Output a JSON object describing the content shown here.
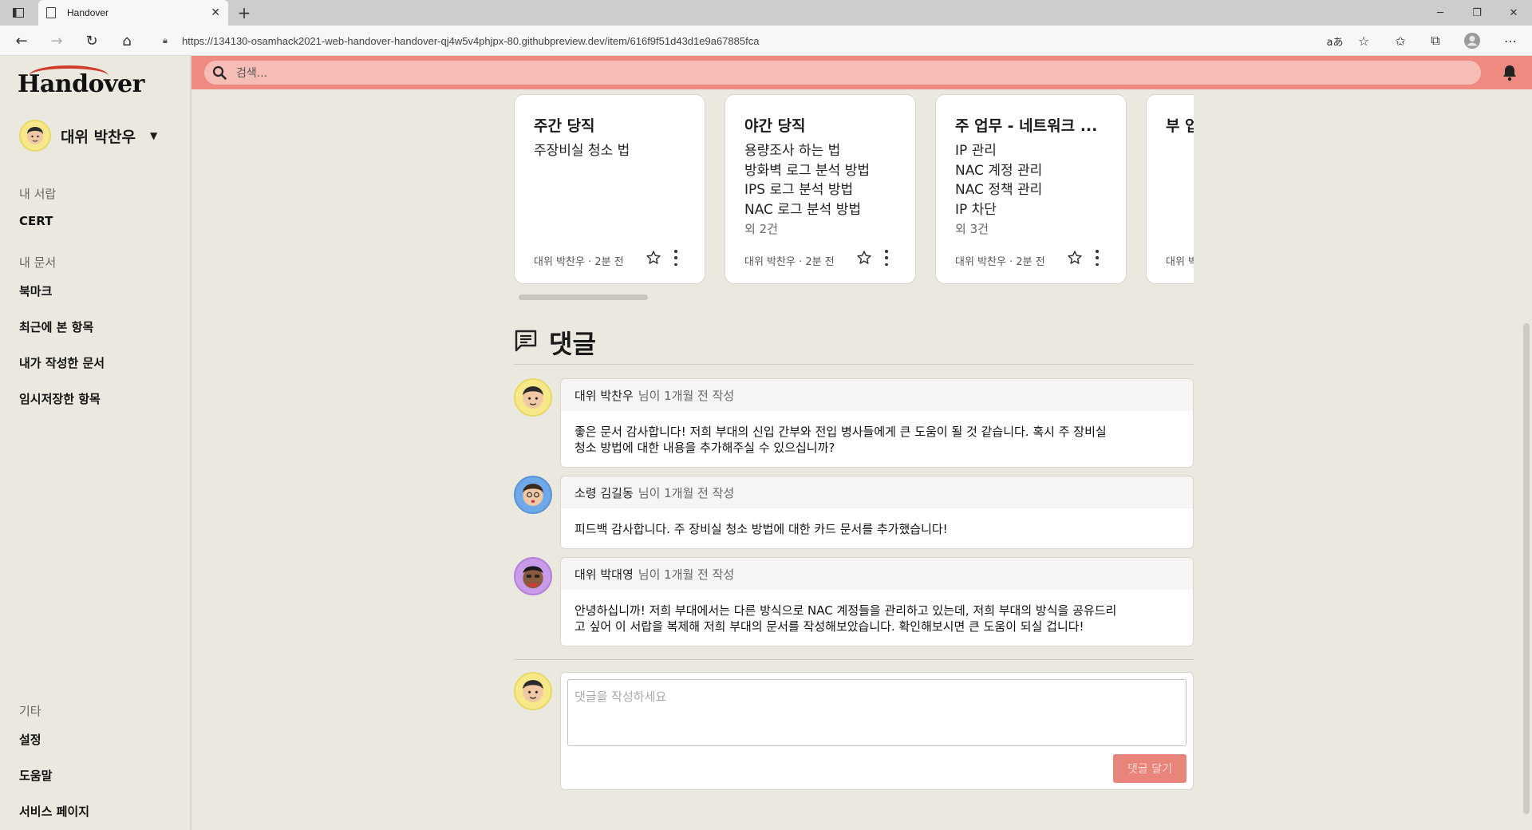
{
  "browser": {
    "tab_title": "Handover",
    "url": "https://134130-osamhack2021-web-handover-handover-qj4w5v4phjpx-80.githubpreview.dev/item/616f9f51d43d1e9a67885fca"
  },
  "sidebar": {
    "logo": "Handover",
    "user_name": "대위 박찬우",
    "sections": {
      "library": "내 서랍",
      "documents": "내 문서",
      "etc": "기타"
    },
    "library_items": [
      "CERT"
    ],
    "document_items": [
      "북마크",
      "최근에 본 항목",
      "내가 작성한 문서",
      "임시저장한 항목"
    ],
    "etc_items": [
      "설정",
      "도움말",
      "서비스 페이지"
    ]
  },
  "search": {
    "placeholder": "검색..."
  },
  "cards": [
    {
      "title": "주간 당직",
      "items": [
        "주장비실 청소 법"
      ],
      "more": "",
      "author": "대위 박찬우",
      "time": "2분 전"
    },
    {
      "title": "야간 당직",
      "items": [
        "용량조사 하는 법",
        "방화벽 로그 분석 방법",
        "IPS 로그 분석 방법",
        "NAC 로그 분석 방법"
      ],
      "more": "외 2건",
      "author": "대위 박찬우",
      "time": "2분 전"
    },
    {
      "title": "주 업무 - 네트워크 ...",
      "items": [
        "IP 관리",
        "NAC 계정 관리",
        "NAC 정책 관리",
        "IP 차단"
      ],
      "more": "외 3건",
      "author": "대위 박찬우",
      "time": "2분 전"
    },
    {
      "title": "부 업",
      "items": [],
      "more": "",
      "author": "대위 박",
      "time": ""
    }
  ],
  "comments_section": {
    "title": "댓글",
    "items": [
      {
        "author": "대위 박찬우",
        "meta": "님이 1개월 전 작성",
        "body_lines": [
          "좋은 문서 감사합니다! 저희 부대의 신입 간부와 전입 병사들에게 큰 도움이 될 것 같습니다. 혹시 주 장비실",
          "청소 방법에 대한 내용을 추가해주실 수 있으십니까?"
        ],
        "avatar_color": "#f7e98a"
      },
      {
        "author": "소령 김길동",
        "meta": "님이 1개월 전 작성",
        "body_lines": [
          "피드백 감사합니다. 주 장비실 청소 방법에 대한 카드 문서를 추가했습니다!"
        ],
        "avatar_color": "#6fa8e8"
      },
      {
        "author": "대위 박대영",
        "meta": "님이 1개월 전 작성",
        "body_lines": [
          "안녕하십니까! 저희 부대에서는 다른 방식으로 NAC 계정들을 관리하고 있는데, 저희 부대의 방식을 공유드리",
          "고 싶어 이 서랍을 복제해 저희 부대의 문서를 작성해보았습니다. 확인해보시면 큰 도움이 되실 겁니다!"
        ],
        "avatar_color": "#c99ae8"
      }
    ],
    "compose": {
      "placeholder": "댓글을 작성하세요",
      "submit": "댓글 달기"
    }
  },
  "colors": {
    "accent": "#ee8a80",
    "search_bg": "#f5bdb6",
    "page_bg": "#ebe8df",
    "button": "#e9847a"
  }
}
